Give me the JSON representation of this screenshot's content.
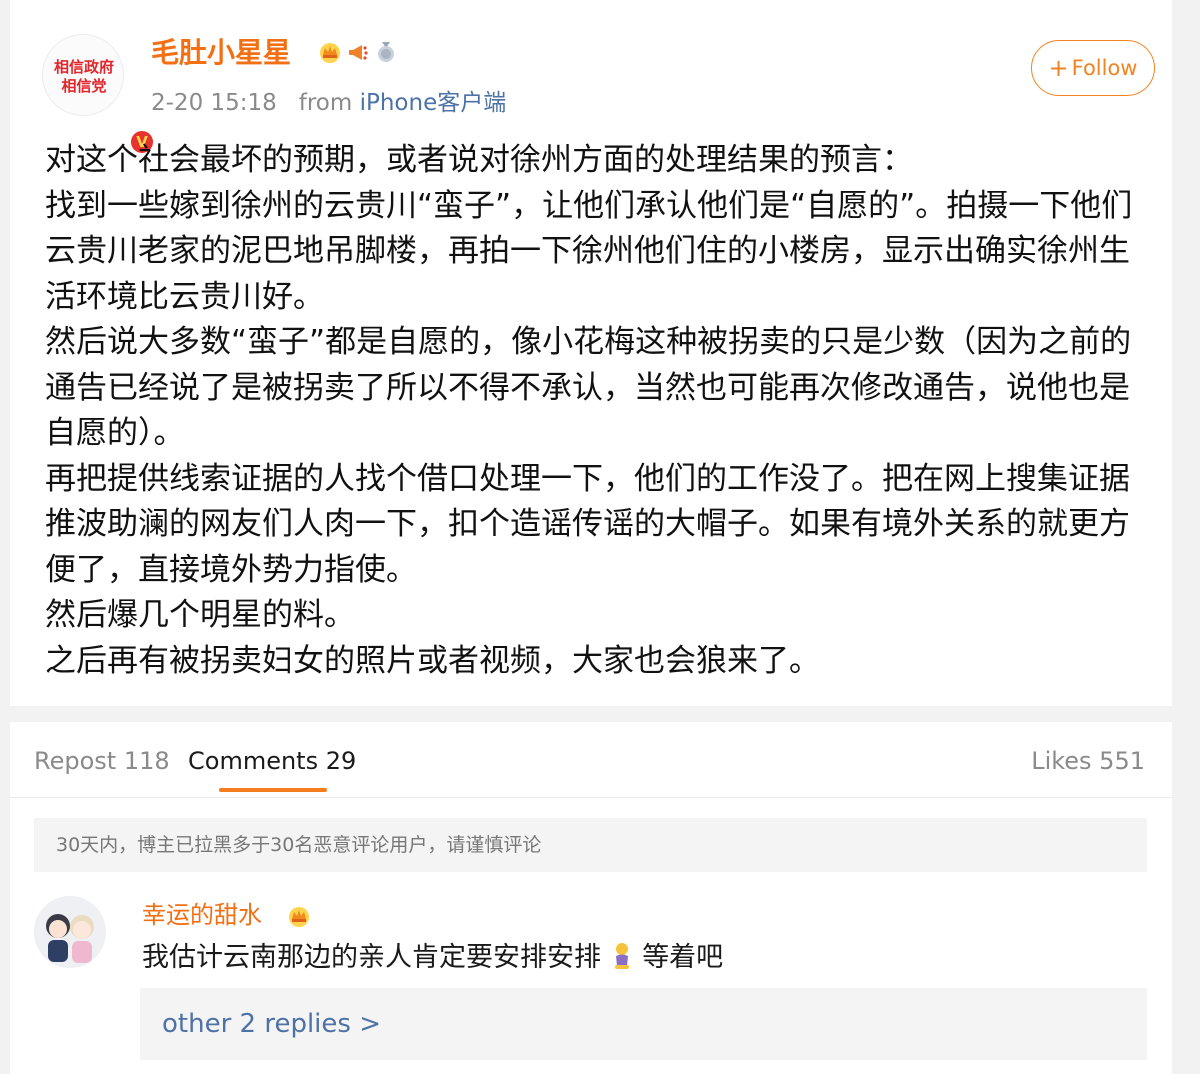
{
  "post": {
    "avatar_lines": [
      "相信政府",
      "相信党"
    ],
    "verified_badge": "V",
    "username": "毛肚小星星",
    "badges": [
      "crown-badge-icon",
      "megaphone-badge-icon",
      "medal-badge-icon"
    ],
    "timestamp": "2-20 15:18",
    "from_label": "from",
    "source": "iPhone客户端",
    "follow_label": "Follow",
    "follow_icon": "+",
    "body_lines": [
      "对这个社会最坏的预期，或者说对徐州方面的处理结果的预言：",
      "找到一些嫁到徐州的云贵川“蛮子”，让他们承认他们是“自愿的”。拍摄一下他们云贵川老家的泥巴地吊脚楼，再拍一下徐州他们住的小楼房，显示出确实徐州生活环境比云贵川好。",
      "然后说大多数“蛮子”都是自愿的，像小花梅这种被拐卖的只是少数（因为之前的通告已经说了是被拐卖了所以不得不承认，当然也可能再次修改通告，说他也是自愿的）。",
      "再把提供线索证据的人找个借口处理一下，他们的工作没了。把在网上搜集证据推波助澜的网友们人肉一下，扣个造谣传谣的大帽子。如果有境外关系的就更方便了，直接境外势力指使。",
      "然后爆几个明星的料。",
      "之后再有被拐卖妇女的照片或者视频，大家也会狼来了。"
    ]
  },
  "tabs": {
    "repost": "Repost 118",
    "comments": "Comments 29",
    "likes": "Likes 551"
  },
  "notice": "30天内，博主已拉黑多于30名恶意评论用户，请谨慎评论",
  "comment": {
    "username": "幸运的甜水",
    "text": "我估计云南那边的亲人肯定要安排安排",
    "emoji": "kneeling-person-emoji",
    "text_after": "等着吧",
    "replies_link": "other 2 replies >"
  },
  "colors": {
    "username": "#f36f14",
    "accent": "#f57c1f",
    "link": "#4d72a5",
    "verified": "#e8322e"
  }
}
